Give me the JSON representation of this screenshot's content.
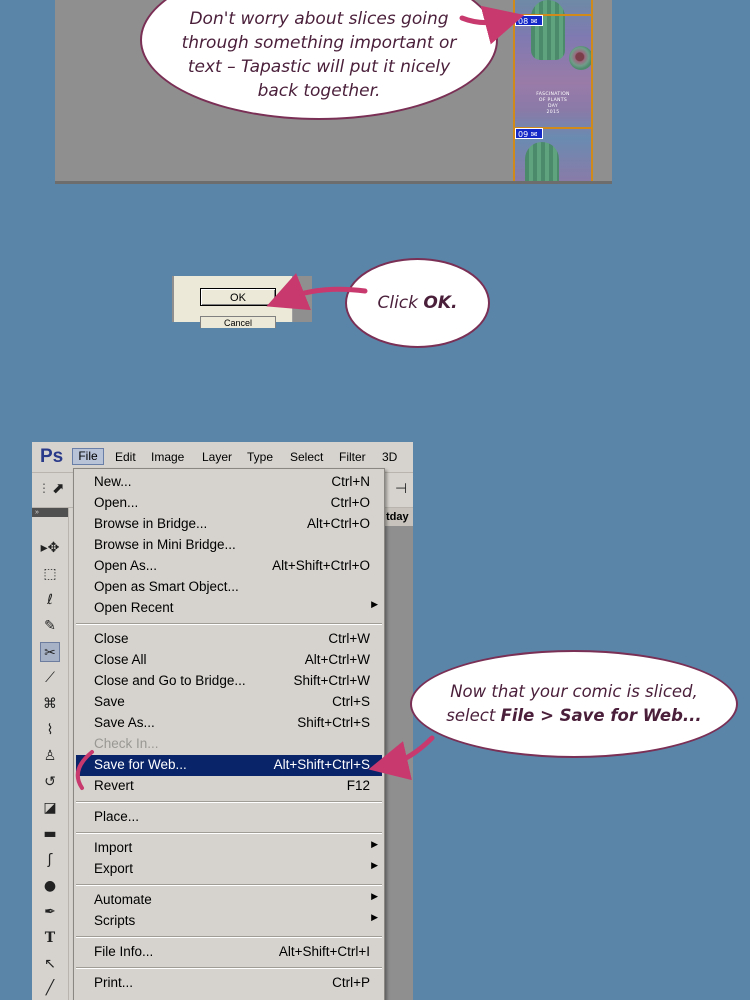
{
  "panel1": {
    "bubble_text": "Don't worry about slices going through something important or text – Tapastic will put it nicely back together.",
    "slice_tags": [
      "08",
      "09"
    ],
    "strip_lines": [
      "FASCINATION",
      "OF PLANTS",
      "DAY",
      "2015"
    ]
  },
  "panel2": {
    "ok_label": "OK",
    "cancel_label": "Cancel",
    "bubble_prefix": "Click ",
    "bubble_bold": "OK."
  },
  "photoshop": {
    "logo": "Ps",
    "menubar": [
      "File",
      "Edit",
      "Image",
      "Layer",
      "Type",
      "Select",
      "Filter",
      "3D"
    ],
    "doc_tab": "tday",
    "file_menu": [
      {
        "label": "New...",
        "shortcut": "Ctrl+N"
      },
      {
        "label": "Open...",
        "shortcut": "Ctrl+O"
      },
      {
        "label": "Browse in Bridge...",
        "shortcut": "Alt+Ctrl+O"
      },
      {
        "label": "Browse in Mini Bridge...",
        "shortcut": ""
      },
      {
        "label": "Open As...",
        "shortcut": "Alt+Shift+Ctrl+O"
      },
      {
        "label": "Open as Smart Object...",
        "shortcut": ""
      },
      {
        "label": "Open Recent",
        "shortcut": "",
        "submenu": true
      },
      {
        "separator": true
      },
      {
        "label": "Close",
        "shortcut": "Ctrl+W"
      },
      {
        "label": "Close All",
        "shortcut": "Alt+Ctrl+W"
      },
      {
        "label": "Close and Go to Bridge...",
        "shortcut": "Shift+Ctrl+W"
      },
      {
        "label": "Save",
        "shortcut": "Ctrl+S"
      },
      {
        "label": "Save As...",
        "shortcut": "Shift+Ctrl+S"
      },
      {
        "label": "Check In...",
        "shortcut": "",
        "disabled": true
      },
      {
        "label": "Save for Web...",
        "shortcut": "Alt+Shift+Ctrl+S",
        "selected": true
      },
      {
        "label": "Revert",
        "shortcut": "F12"
      },
      {
        "separator": true
      },
      {
        "label": "Place...",
        "shortcut": ""
      },
      {
        "separator": true
      },
      {
        "label": "Import",
        "shortcut": "",
        "submenu": true
      },
      {
        "label": "Export",
        "shortcut": "",
        "submenu": true
      },
      {
        "separator": true
      },
      {
        "label": "Automate",
        "shortcut": "",
        "submenu": true
      },
      {
        "label": "Scripts",
        "shortcut": "",
        "submenu": true
      },
      {
        "separator": true
      },
      {
        "label": "File Info...",
        "shortcut": "Alt+Shift+Ctrl+I"
      },
      {
        "separator": true
      },
      {
        "label": "Print...",
        "shortcut": "Ctrl+P"
      }
    ],
    "tools": [
      "move-tool",
      "marquee-tool",
      "lasso-tool",
      "quick-select-tool",
      "slice-tool",
      "eyedropper-tool",
      "healing-tool",
      "brush-tool",
      "stamp-tool",
      "history-brush-tool",
      "eraser-tool",
      "gradient-tool",
      "blur-tool",
      "dodge-tool",
      "pen-tool",
      "type-tool",
      "path-select-tool",
      "shape-tool"
    ]
  },
  "panel3": {
    "bubble_line1": "Now that your comic is sliced,",
    "bubble_line2_prefix": "select ",
    "bubble_line2_bold": "File > Save for Web..."
  },
  "colors": {
    "background": "#5a85a9",
    "bubble_border": "#7a2f55",
    "arrow": "#c83a6e",
    "menu_highlight": "#0a246a",
    "slice_line": "#d08a1a"
  }
}
